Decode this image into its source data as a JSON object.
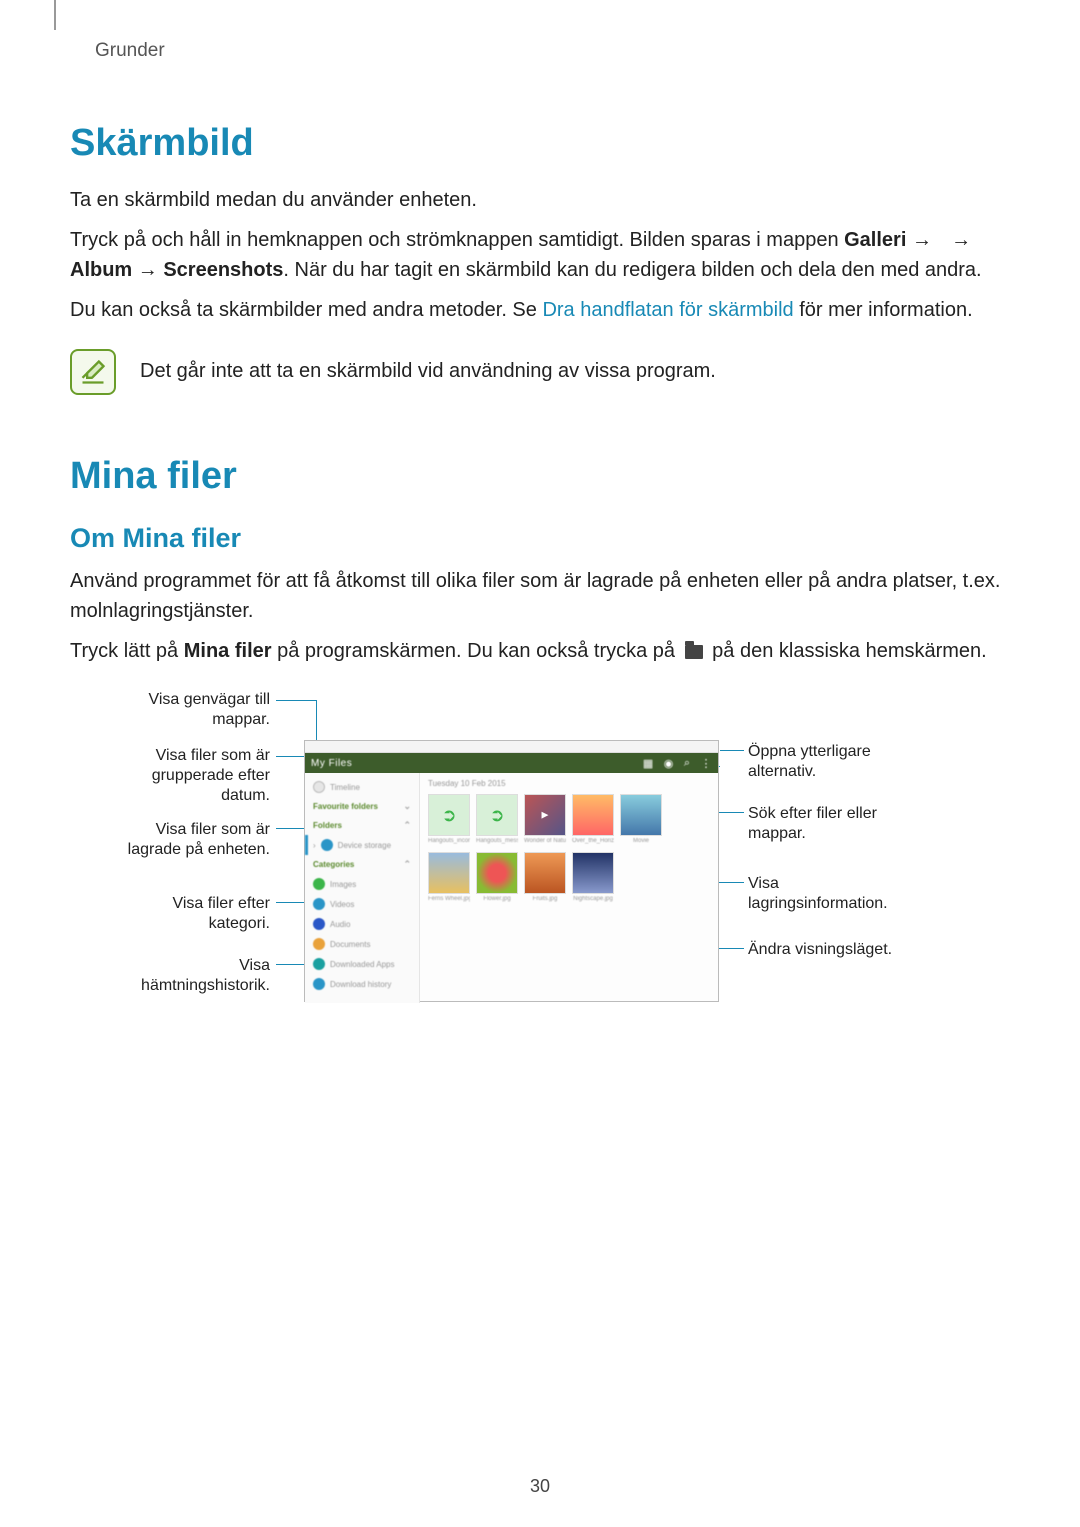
{
  "header": {
    "section": "Grunder"
  },
  "h1a": "Skärmbild",
  "body": {
    "p1": "Ta en skärmbild medan du använder enheten.",
    "p2a": "Tryck på och håll in hemknappen och strömknappen samtidigt. Bilden sparas i mappen ",
    "p2b": "Galleri",
    "p2c": " → ",
    "p2d": " → ",
    "p2e": "Album",
    "p2f": " → ",
    "p2g": "Screenshots",
    "p2h": ". När du har tagit en skärmbild kan du redigera bilden och dela den med andra.",
    "p3a": "Du kan också ta skärmbilder med andra metoder. Se ",
    "p3link": "Dra handflatan för skärmbild",
    "p3b": " för mer information.",
    "note": "Det går inte att ta en skärmbild vid användning av vissa program."
  },
  "h1b": "Mina filer",
  "h2a": "Om Mina filer",
  "body2": {
    "p1": "Använd programmet för att få åtkomst till olika filer som är lagrade på enheten eller på andra platser, t.ex. molnlagringstjänster.",
    "p2a": "Tryck lätt på ",
    "p2b": "Mina filer",
    "p2c": " på programskärmen. Du kan också trycka på ",
    "p2d": " på den klassiska hemskärmen."
  },
  "diagram": {
    "left": {
      "shortcuts": "Visa genvägar till\nmappar.",
      "bydate": "Visa filer som är\ngrupperade efter\ndatum.",
      "ondevice": "Visa filer som är\nlagrade på enheten.",
      "bycat": "Visa filer efter\nkategori.",
      "history": "Visa\nhämtningshistorik."
    },
    "right": {
      "more": "Öppna ytterligare\nalternativ.",
      "search": "Sök efter filer eller\nmappar.",
      "storage": "Visa\nlagringsinformation.",
      "viewmode": "Ändra visningsläget."
    }
  },
  "phone": {
    "title": "My Files",
    "date": "Tuesday  10 Feb 2015",
    "rows": {
      "timeline": "Timeline",
      "favorite": "Favourite folders",
      "folders": "Folders",
      "device": "Device storage",
      "categories": "Categories",
      "images": "Images",
      "videos": "Videos",
      "audio": "Audio",
      "documents": "Documents",
      "apps": "Downloaded Apps",
      "history": "Download history"
    },
    "thumbs_row1": [
      "Hangouts_incom...",
      "Hangouts_mess...",
      "Wonder of Natur...",
      "Over_the_Horizo...",
      "Movie"
    ],
    "thumbs_row2": [
      "Ferris Wheel.jpg",
      "Flower.jpg",
      "Fruits.jpg",
      "Nightscape.jpg",
      ""
    ]
  },
  "pagenum": "30"
}
